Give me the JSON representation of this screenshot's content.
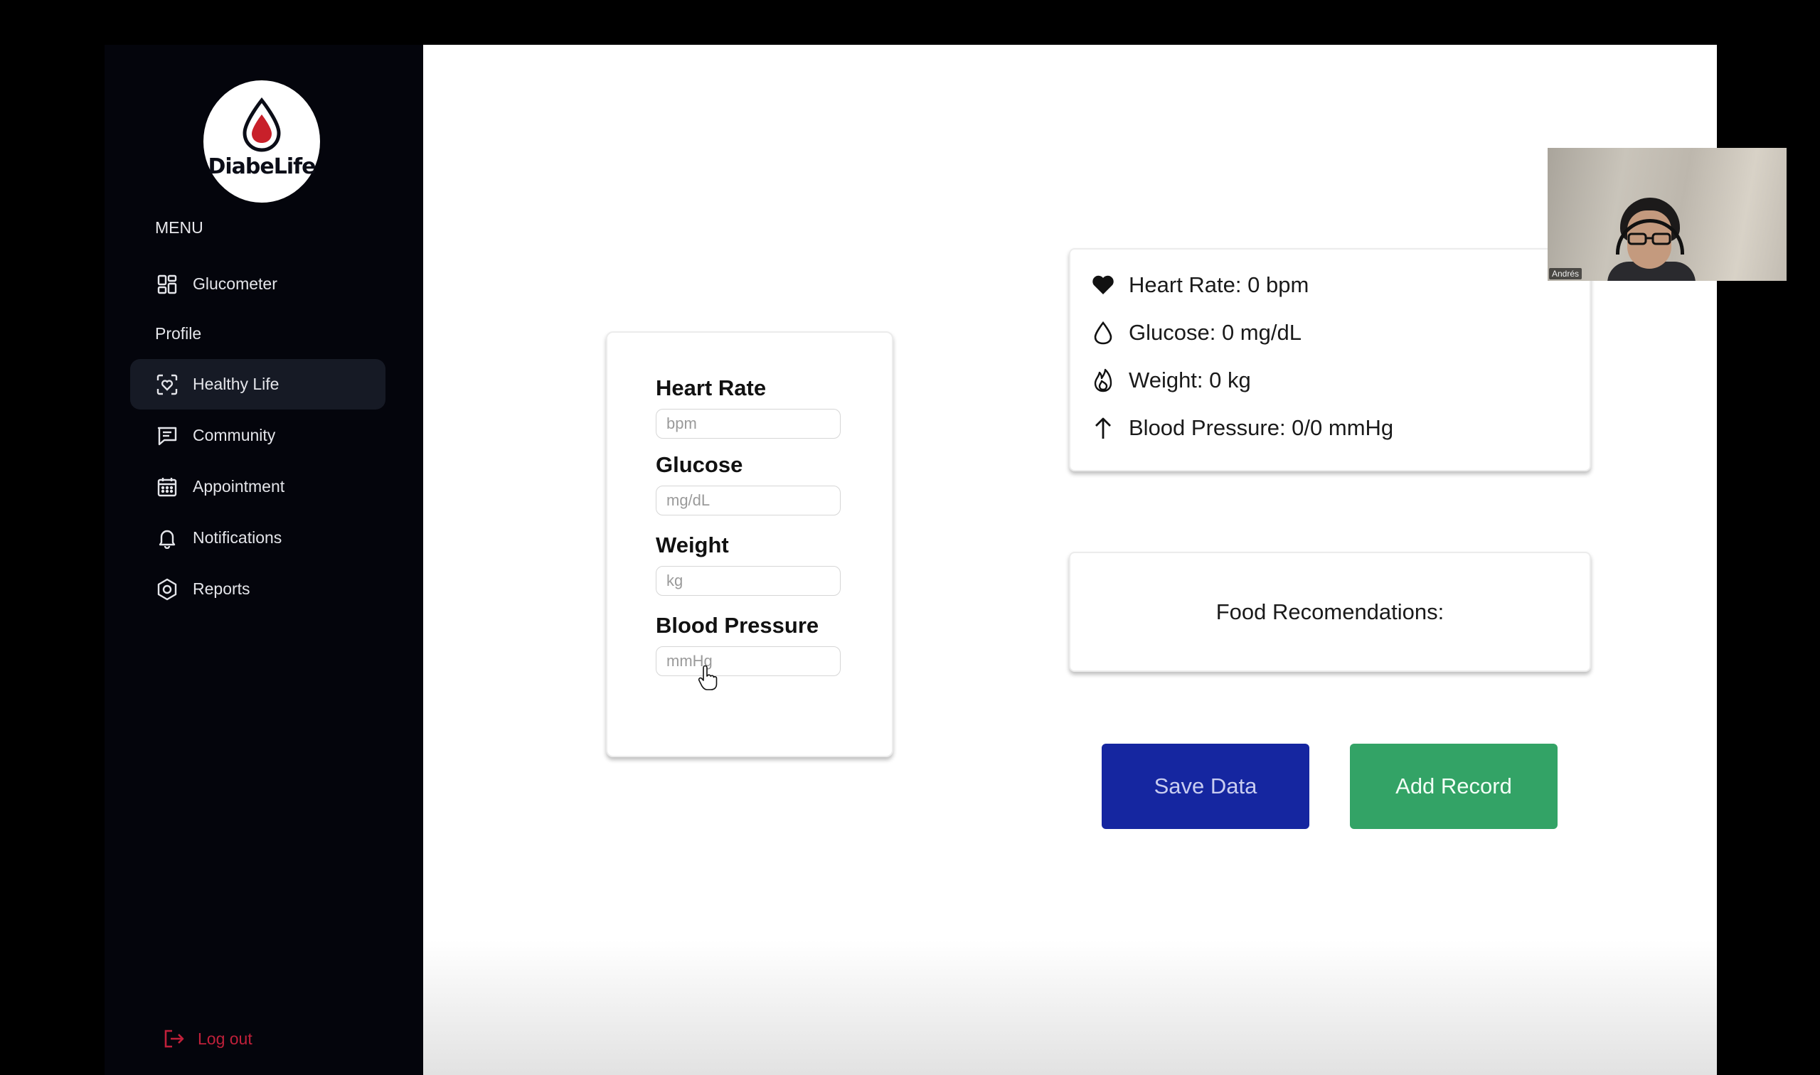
{
  "app": {
    "brand": "DiabeLife",
    "menu_label": "MENU",
    "accent_color": "#1526a0",
    "success_color": "#33a366",
    "danger_color": "#c0203a"
  },
  "sidebar": {
    "items": [
      {
        "label": "Glucometer",
        "icon": "grid-icon"
      },
      {
        "label": "Profile",
        "icon": null
      },
      {
        "label": "Healthy Life",
        "icon": "heart-scan-icon",
        "active": true
      },
      {
        "label": "Community",
        "icon": "message-icon"
      },
      {
        "label": "Appointment",
        "icon": "calendar-icon"
      },
      {
        "label": "Notifications",
        "icon": "bell-icon"
      },
      {
        "label": "Reports",
        "icon": "hexagon-settings-icon"
      }
    ],
    "logout_label": "Log out"
  },
  "form": {
    "heart_rate": {
      "label": "Heart Rate",
      "placeholder": "bpm",
      "value": ""
    },
    "glucose": {
      "label": "Glucose",
      "placeholder": "mg/dL",
      "value": ""
    },
    "weight": {
      "label": "Weight",
      "placeholder": "kg",
      "value": ""
    },
    "blood_pressure": {
      "label": "Blood Pressure",
      "placeholder": "mmHg",
      "value": ""
    }
  },
  "stats": {
    "heart_rate": "Heart Rate: 0 bpm",
    "glucose": "Glucose: 0 mg/dL",
    "weight": "Weight: 0 kg",
    "blood_pressure": "Blood Pressure: 0/0 mmHg"
  },
  "food": {
    "title": "Food Recomendations:"
  },
  "buttons": {
    "save": "Save Data",
    "add": "Add Record"
  },
  "webcam": {
    "participant_name": "Andrés"
  }
}
